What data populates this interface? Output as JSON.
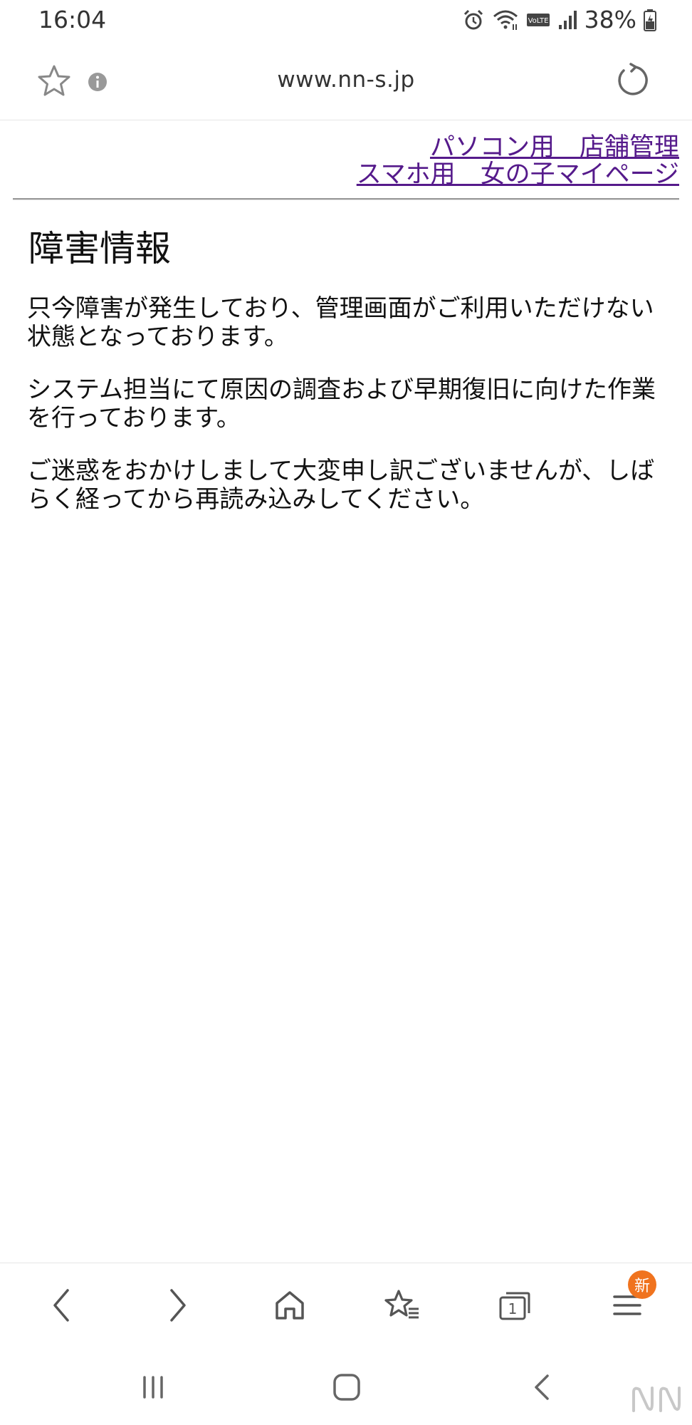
{
  "status_bar": {
    "time": "16:04",
    "battery_percent": "38%",
    "volte_label": "VoLTE",
    "icons": [
      "alarm-icon",
      "wifi-icon",
      "volte-icon",
      "signal-icon",
      "battery-icon"
    ]
  },
  "url_bar": {
    "url": "www.nn-s.jp"
  },
  "links": {
    "pc_store_admin": "パソコン用　店舗管理",
    "sp_girl_mypage": "スマホ用　女の子マイページ"
  },
  "main": {
    "title": "障害情報",
    "paragraphs": [
      "只今障害が発生しており、管理画面がご利用いただけない状態となっております。",
      "システム担当にて原因の調査および早期復旧に向けた作業を行っております。",
      "ご迷惑をおかけしまして大変申し訳ございませんが、しばらく経ってから再読み込みしてください。"
    ]
  },
  "toolbar": {
    "tab_count": "1",
    "menu_badge": "新"
  },
  "colors": {
    "link": "#551a8b",
    "badge": "#f0731e"
  }
}
